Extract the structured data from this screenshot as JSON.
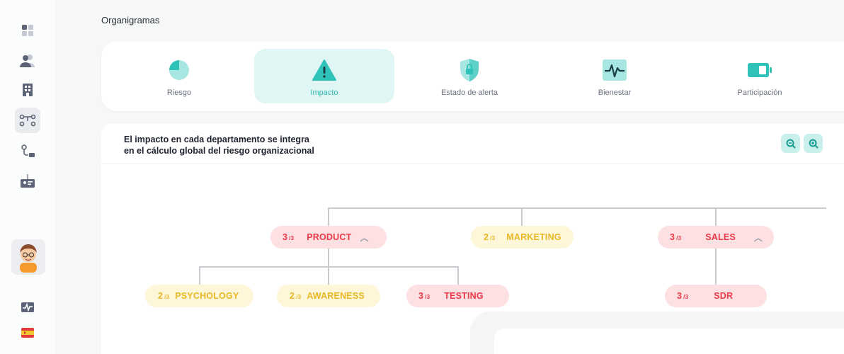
{
  "breadcrumb": {
    "title": "Organigramas"
  },
  "sidebar": {
    "items": [
      {
        "name": "dashboard-icon"
      },
      {
        "name": "people-icon"
      },
      {
        "name": "building-icon"
      },
      {
        "name": "org-chart-icon",
        "active": true
      },
      {
        "name": "flow-icon"
      },
      {
        "name": "id-card-icon"
      },
      {
        "name": "activity-icon"
      },
      {
        "name": "spain-flag-icon"
      }
    ]
  },
  "tabs": [
    {
      "label": "Riesgo",
      "icon": "pie-chart-icon"
    },
    {
      "label": "Impacto",
      "icon": "warning-icon",
      "active": true
    },
    {
      "label": "Estado de alerta",
      "icon": "shield-lock-icon"
    },
    {
      "label": "Bienestar",
      "icon": "heartbeat-icon"
    },
    {
      "label": "Participación",
      "icon": "battery-icon"
    }
  ],
  "main": {
    "heading_line1": "El impacto en cada departamento se integra",
    "heading_line2": "en el cálculo global del riesgo organizacional",
    "zoom_out_icon": "zoom-out-icon",
    "zoom_in_icon": "zoom-in-icon"
  },
  "org": {
    "score_suffix": "/3",
    "nodes": {
      "product": {
        "score": "3",
        "label": "PRODUCT",
        "level": "red"
      },
      "marketing": {
        "score": "2",
        "label": "MARKETING",
        "level": "yellow"
      },
      "sales": {
        "score": "3",
        "label": "SALES",
        "level": "red"
      },
      "psychology": {
        "score": "2",
        "label": "PSYCHOLOGY",
        "level": "yellow"
      },
      "awareness": {
        "score": "2",
        "label": "AWARENESS",
        "level": "yellow"
      },
      "testing": {
        "score": "3",
        "label": "TESTING",
        "level": "red"
      },
      "sdr": {
        "score": "3",
        "label": "SDR",
        "level": "red"
      }
    }
  },
  "colors": {
    "accent": "#2fc2b8",
    "red": "#ea3a4a",
    "yellow": "#e8b825"
  }
}
